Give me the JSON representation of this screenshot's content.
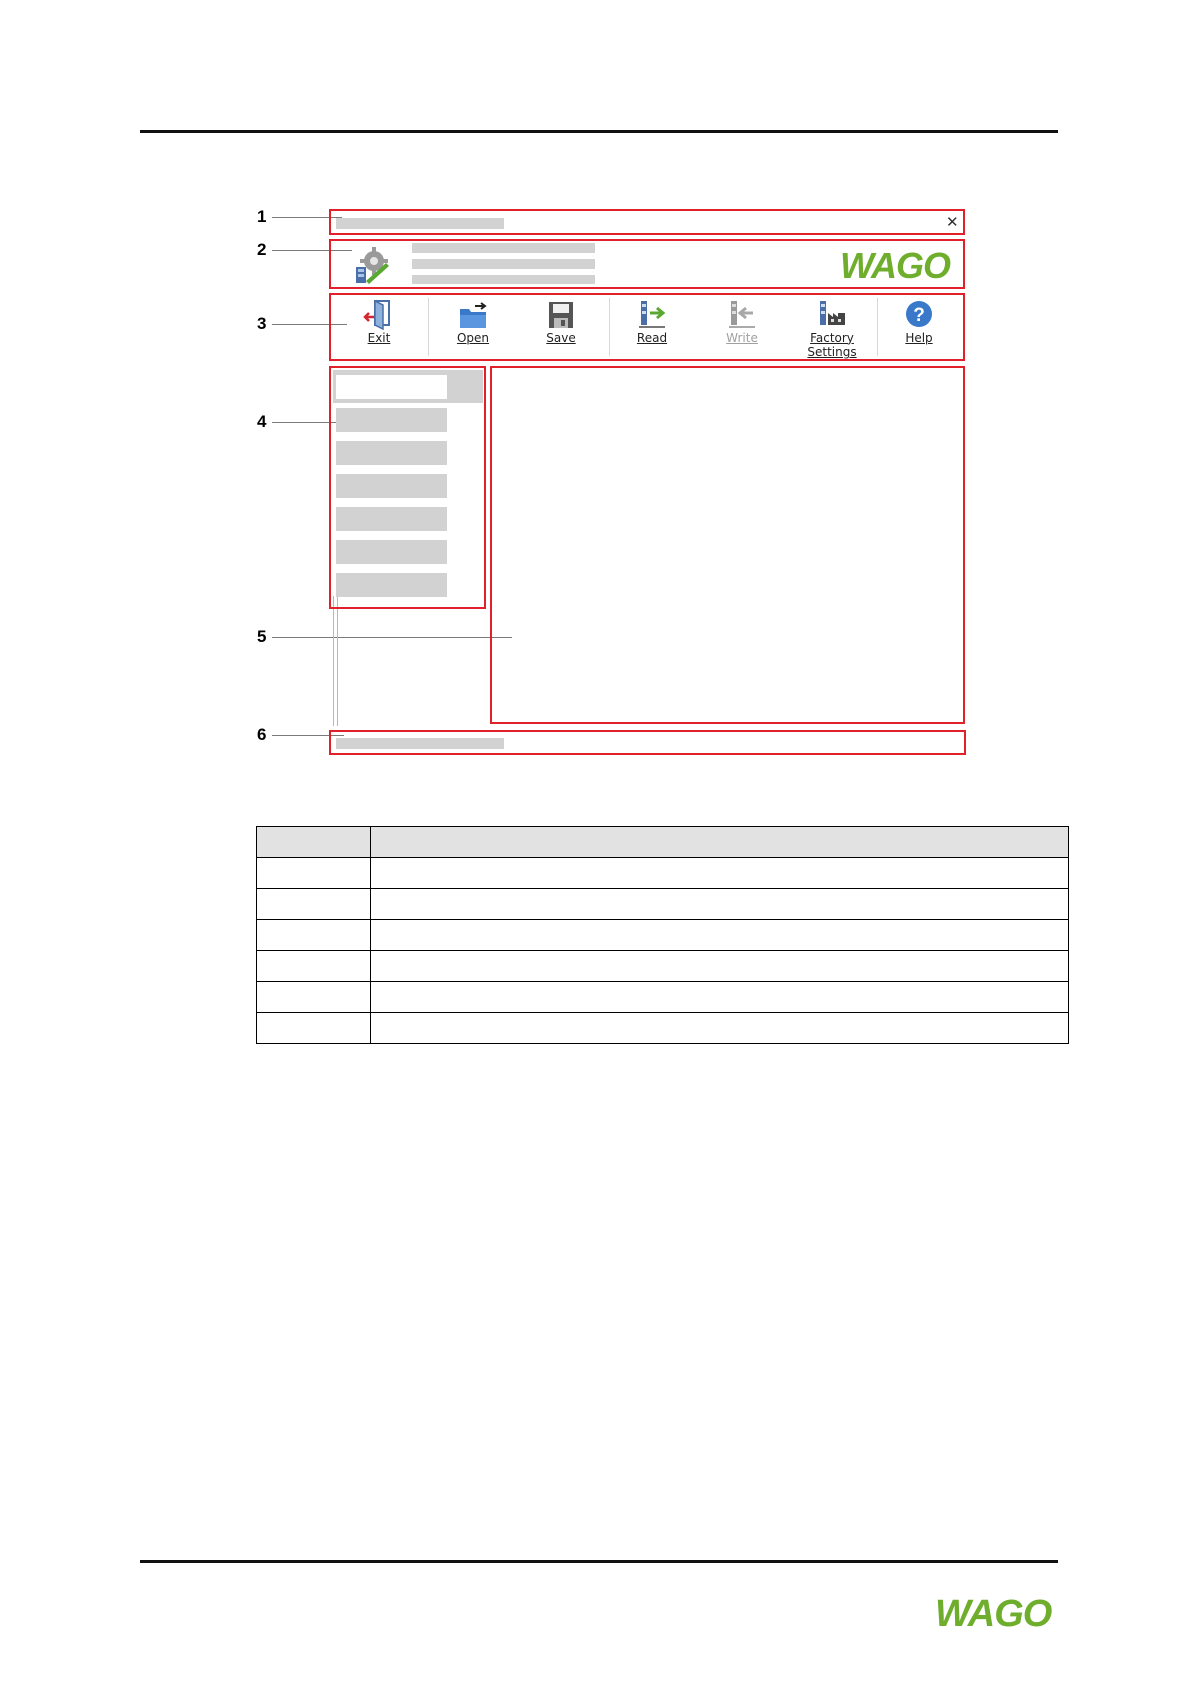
{
  "figure": {
    "callouts": [
      "1",
      "2",
      "3",
      "4",
      "5",
      "6"
    ],
    "title_bar": {
      "close_glyph": "✕"
    },
    "toolbar": {
      "buttons": [
        {
          "id": "exit",
          "label": "Exit",
          "icon": "exit-icon",
          "enabled": true
        },
        {
          "id": "open",
          "label": "Open",
          "icon": "folder-open-icon",
          "enabled": true
        },
        {
          "id": "save",
          "label": "Save",
          "icon": "floppy-disk-icon",
          "enabled": true
        },
        {
          "id": "read",
          "label": "Read",
          "icon": "read-device-icon",
          "enabled": true
        },
        {
          "id": "write",
          "label": "Write",
          "icon": "write-device-icon",
          "enabled": false
        },
        {
          "id": "factory",
          "label": "Factory Settings",
          "icon": "factory-icon",
          "enabled": true
        },
        {
          "id": "help",
          "label": "Help",
          "icon": "help-icon",
          "enabled": true
        }
      ]
    },
    "logo": "WAGO",
    "colors": {
      "highlight": "#e0202a",
      "brand_green": "#6fae2c",
      "placeholder": "#d2d2d2"
    }
  },
  "legend_table": {
    "rows": 6
  },
  "footer": {
    "logo": "WAGO"
  }
}
